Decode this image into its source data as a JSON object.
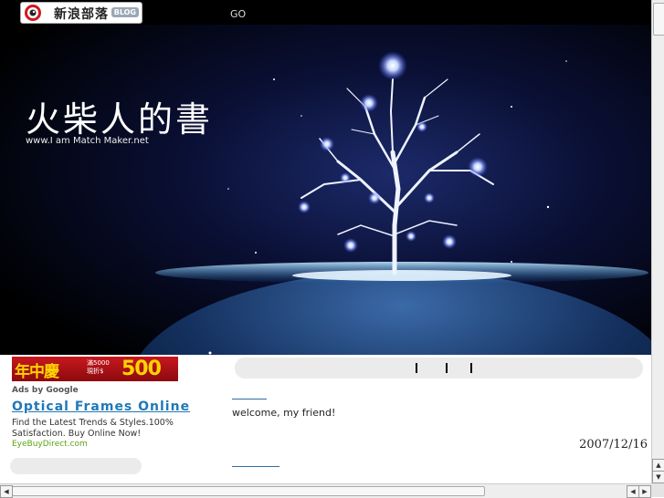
{
  "topbar": {
    "logo_text": "新浪部落",
    "logo_badge": "BLOG",
    "go_label": "GO"
  },
  "banner": {
    "title": "火柴人的書",
    "url": "www.I am Match Maker.net"
  },
  "sidebar": {
    "ad_banner": {
      "line1": "年中慶",
      "line2a": "滿5000",
      "line2b": "現折$",
      "amount": "500"
    },
    "ads_by": "Ads by Google",
    "ad_title": "Optical Frames Online",
    "ad_desc": "Find the Latest Trends & Styles.100% Satisfaction. Buy Online Now!",
    "ad_url": "EyeBuyDirect.com"
  },
  "main": {
    "welcome": "welcome, my friend!",
    "date": "2007/12/16"
  },
  "colors": {
    "link": "#2079b8",
    "ad_url": "#5da515",
    "rule": "#2e6ca6"
  }
}
